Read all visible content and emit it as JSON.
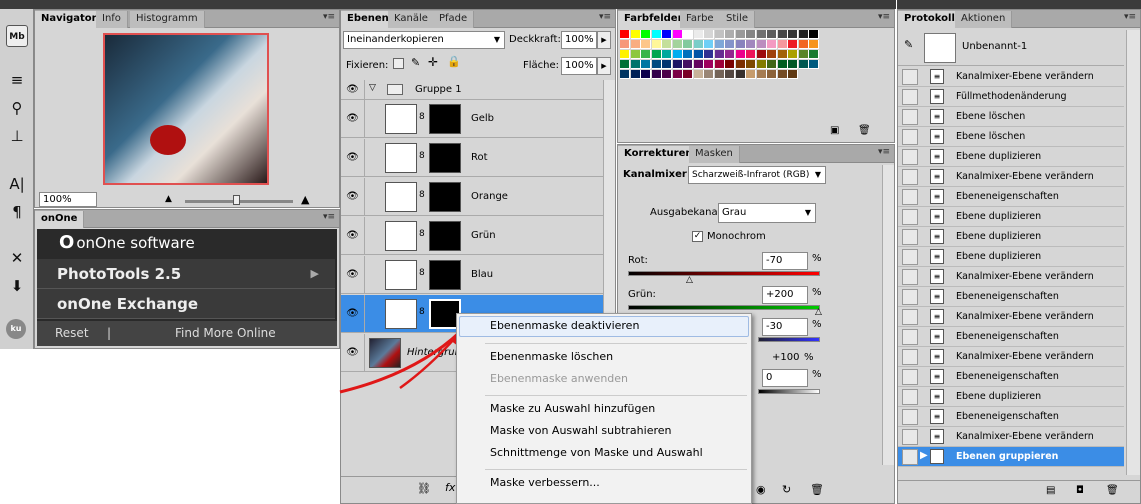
{
  "navigator": {
    "tabs": [
      "Navigator",
      "Info",
      "Histogramm"
    ],
    "zoom": "100%"
  },
  "onone": {
    "tab": "onOne",
    "logo_text": "onOne software",
    "items": [
      "PhotoTools 2.5",
      "onOne Exchange"
    ],
    "reset": "Reset",
    "separator": "|",
    "find_more": "Find More Online"
  },
  "layers": {
    "tabs": [
      "Ebenen",
      "Kanäle",
      "Pfade"
    ],
    "blend_mode": "Ineinanderkopieren",
    "opacity_label": "Deckkraft:",
    "opacity": "100%",
    "lock_label": "Fixieren:",
    "fill_label": "Fläche:",
    "fill": "100%",
    "group_name": "Gruppe 1",
    "rows": [
      {
        "name": "Gelb"
      },
      {
        "name": "Rot"
      },
      {
        "name": "Orange"
      },
      {
        "name": "Grün"
      },
      {
        "name": "Blau"
      },
      {
        "name": ""
      }
    ],
    "background_name": "Hintergrund"
  },
  "swatches": {
    "tabs": [
      "Farbfelder",
      "Farbe",
      "Stile"
    ],
    "colors": [
      "#ff0000",
      "#ffff00",
      "#00ff00",
      "#00ffff",
      "#0000ff",
      "#ff00ff",
      "#ffffff",
      "#ebebeb",
      "#d6d6d6",
      "#c2c2c2",
      "#adadad",
      "#999999",
      "#858585",
      "#707070",
      "#5c5c5c",
      "#474747",
      "#333333",
      "#1f1f1f",
      "#000000",
      "#f7977a",
      "#f9ad81",
      "#fdc68a",
      "#fff79a",
      "#c4df9b",
      "#a3d39c",
      "#82ca9d",
      "#7bcdc8",
      "#6ecff6",
      "#7ea7d8",
      "#8493ca",
      "#8882be",
      "#a187be",
      "#bc8dbf",
      "#f49ac2",
      "#f6989d",
      "#ed1c24",
      "#f26522",
      "#f7941d",
      "#fff200",
      "#8dc73f",
      "#39b54a",
      "#00a651",
      "#00a99d",
      "#00aeef",
      "#0072bc",
      "#0054a6",
      "#2e3192",
      "#662d91",
      "#92278f",
      "#ec008c",
      "#ed145b",
      "#9e0b0f",
      "#a0410d",
      "#a36209",
      "#aba000",
      "#598527",
      "#1a7b30",
      "#007236",
      "#00746b",
      "#0076a3",
      "#004b80",
      "#003471",
      "#1b1464",
      "#440e62",
      "#630460",
      "#9e005d",
      "#9e0039",
      "#790000",
      "#7b2e00",
      "#7d4900",
      "#827b00",
      "#406618",
      "#005e20",
      "#005826",
      "#005952",
      "#005b7f",
      "#003663",
      "#002157",
      "#0d004c",
      "#32004b",
      "#4b0049",
      "#7b0046",
      "#7a0026",
      "#c7b299",
      "#998675",
      "#736357",
      "#534741",
      "#37302d",
      "#c69c6d",
      "#a67c52",
      "#8c6239",
      "#754c24",
      "#603913"
    ]
  },
  "corrections": {
    "tabs": [
      "Korrekturen",
      "Masken"
    ],
    "title": "Kanalmixer",
    "preset": "Scharzweiß-Infrarot (RGB)",
    "output_label": "Ausgabekanal:",
    "output": "Grau",
    "monochrome": "Monochrom",
    "red_label": "Rot:",
    "red": "-70",
    "green_label": "Grün:",
    "green": "+200",
    "blue": "-30",
    "total": "+100",
    "constant": "0",
    "pct": "%"
  },
  "protocol": {
    "tabs": [
      "Protokoll",
      "Aktionen"
    ],
    "snapshot": "Unbenannt-1",
    "items": [
      "Kanalmixer-Ebene verändern",
      "Füllmethodenänderung",
      "Ebene löschen",
      "Ebene löschen",
      "Ebene duplizieren",
      "Kanalmixer-Ebene verändern",
      "Ebeneneigenschaften",
      "Ebene duplizieren",
      "Ebene duplizieren",
      "Ebene duplizieren",
      "Kanalmixer-Ebene verändern",
      "Ebeneneigenschaften",
      "Kanalmixer-Ebene verändern",
      "Ebeneneigenschaften",
      "Kanalmixer-Ebene verändern",
      "Ebeneneigenschaften",
      "Ebene duplizieren",
      "Ebeneneigenschaften",
      "Kanalmixer-Ebene verändern",
      "Ebenen gruppieren"
    ]
  },
  "context_menu": {
    "items": [
      "Ebenenmaske deaktivieren",
      "Ebenenmaske löschen",
      "Ebenenmaske anwenden",
      "Maske zu Auswahl hinzufügen",
      "Maske von Auswahl subtrahieren",
      "Schnittmenge von Maske und Auswahl",
      "Maske verbessern..."
    ]
  },
  "toolbar": {
    "mb_label": "Mb",
    "ku_label": "ku"
  }
}
